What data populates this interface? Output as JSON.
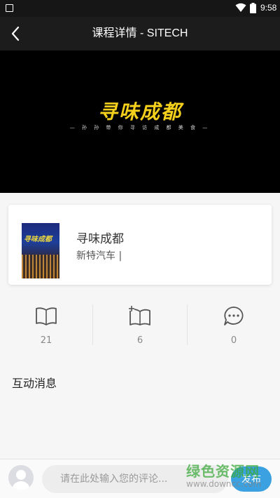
{
  "status_bar": {
    "time": "9:58"
  },
  "header": {
    "title": "课程详情 - SITECH"
  },
  "video": {
    "title": "寻味成都",
    "subtitle": "— 孙 孙 带 你 寻 访 成 都 美 食 —"
  },
  "course": {
    "thumb_text": "寻味成都",
    "title": "寻味成都",
    "org": "新特汽车 |"
  },
  "stats": [
    {
      "icon": "book-icon",
      "value": "21"
    },
    {
      "icon": "add-bookmark-icon",
      "value": "6"
    },
    {
      "icon": "comment-icon",
      "value": "0"
    }
  ],
  "section": {
    "title": "互动消息"
  },
  "comment": {
    "placeholder": "请在此处输入您的评论...",
    "publish_label": "发布"
  },
  "watermark": {
    "text": "绿色资源网",
    "url": "www.downcc.com"
  },
  "colors": {
    "accent": "#3ba1e0",
    "header_bg": "#1c1c1c",
    "video_title": "#f4cf1b"
  }
}
